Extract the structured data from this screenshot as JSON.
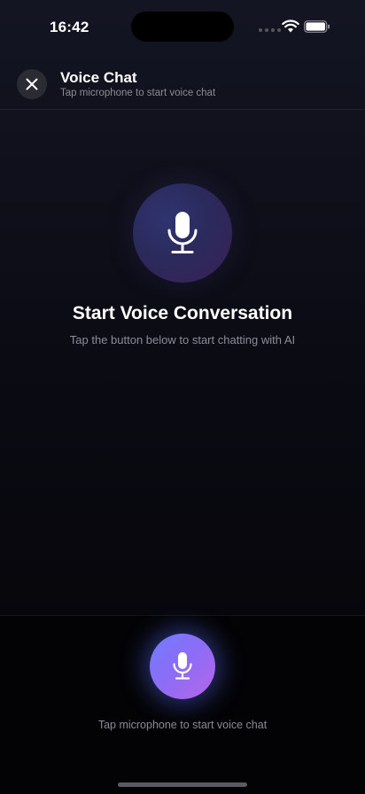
{
  "status_bar": {
    "time": "16:42",
    "icons": [
      "signal-dots-icon",
      "wifi-icon",
      "battery-icon"
    ]
  },
  "header": {
    "close_icon": "close-icon",
    "title": "Voice Chat",
    "subtitle": "Tap microphone to start voice chat"
  },
  "hero": {
    "icon": "microphone-icon",
    "title": "Start Voice Conversation",
    "subtitle": "Tap the button below to start chatting with AI"
  },
  "bottom": {
    "mic_icon": "microphone-icon",
    "hint": "Tap microphone to start voice chat"
  },
  "colors": {
    "accent_start": "#6f7cff",
    "accent_end": "#b766ea",
    "background": "#0b0b14",
    "muted_text": "#8a8b94"
  }
}
